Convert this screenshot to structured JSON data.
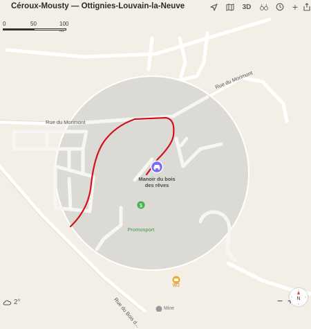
{
  "window": {
    "title": "Céroux-Mousty — Ottignies-Louvain-la-Neuve"
  },
  "toolbar": {
    "icons": [
      "location-arrow-icon",
      "map-mode-icon",
      "3d-toggle",
      "binoculars-icon",
      "clock-icon",
      "add-icon",
      "share-icon"
    ],
    "three_d_label": "3D"
  },
  "scale": {
    "labels": [
      "0",
      "50",
      "100 m"
    ]
  },
  "streets": {
    "rue_du_morimont_1": "Rue du Morimont",
    "rue_du_morimont_2": "Rue du Morimont",
    "rue_du_bois": "Rue du Bois d..."
  },
  "pois": {
    "manoir": {
      "name_line1": "Manoir du bois",
      "name_line2": "des rêves",
      "color": "#7b6ef6"
    },
    "promosport": {
      "name": "Promosport",
      "color": "#4caf50"
    },
    "w2": {
      "name": "W2",
      "color": "#f0a830"
    },
    "mine": {
      "name": "Mine"
    }
  },
  "route": {
    "color": "#d0111b"
  },
  "weather": {
    "temperature": "2°"
  },
  "zoom": {
    "minus": "−",
    "plus": "+"
  },
  "compass": {
    "label": "N"
  }
}
